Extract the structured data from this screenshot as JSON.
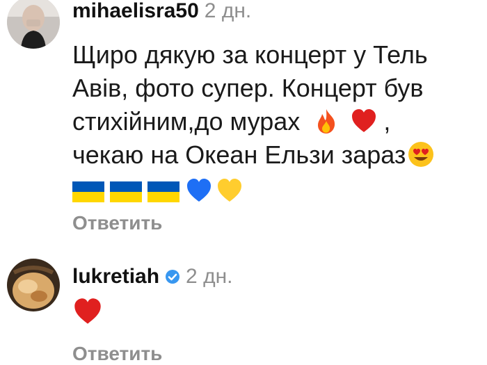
{
  "comments": [
    {
      "username": "mihaelisra50",
      "time": "2 дн.",
      "lines": [
        "Щиро дякую за концерт у Тель",
        "Авів, фото супер. Концерт був",
        "стихійним,до мурах",
        "чекаю на Океан Ельзи зараз"
      ],
      "line3_suffix": ",",
      "emojis": [
        "fire-emoji",
        "red-heart-emoji",
        "heart-eyes-emoji",
        "ukraine-flag-emoji",
        "blue-heart-emoji",
        "yellow-heart-emoji"
      ],
      "reply_label": "Ответить"
    },
    {
      "username": "lukretiah",
      "time": "2 дн.",
      "verified": true,
      "emojis": [
        "red-heart-emoji"
      ],
      "reply_label": "Ответить"
    }
  ],
  "colors": {
    "username": "#111111",
    "meta": "#8e8e8e",
    "verified": "#3897f0",
    "ua_blue": "#0057b7",
    "ua_yellow": "#ffd700"
  }
}
